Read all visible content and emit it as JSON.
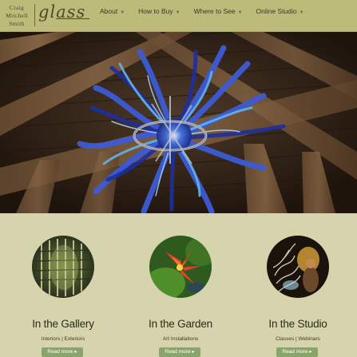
{
  "brand": {
    "name_lines": [
      "Craig",
      "Mitchell",
      "Smith"
    ],
    "script": "glass"
  },
  "nav": {
    "items": [
      {
        "label": "About"
      },
      {
        "label": "How to Buy"
      },
      {
        "label": "Where to See"
      },
      {
        "label": "Online Studio"
      }
    ]
  },
  "cards": [
    {
      "title": "In the Gallery",
      "subtitle": "Interiors | Exteriors",
      "button": "Read more ▸"
    },
    {
      "title": "In the Garden",
      "subtitle": "Art Installations",
      "button": "Read more ▸"
    },
    {
      "title": "In the Studio",
      "subtitle": "Classes | Webinars",
      "button": "Read more ▸"
    }
  ],
  "colors": {
    "header_bg": "#bdbb7a",
    "page_bg": "#d6d4ad",
    "button_bg": "#8aa56b"
  }
}
